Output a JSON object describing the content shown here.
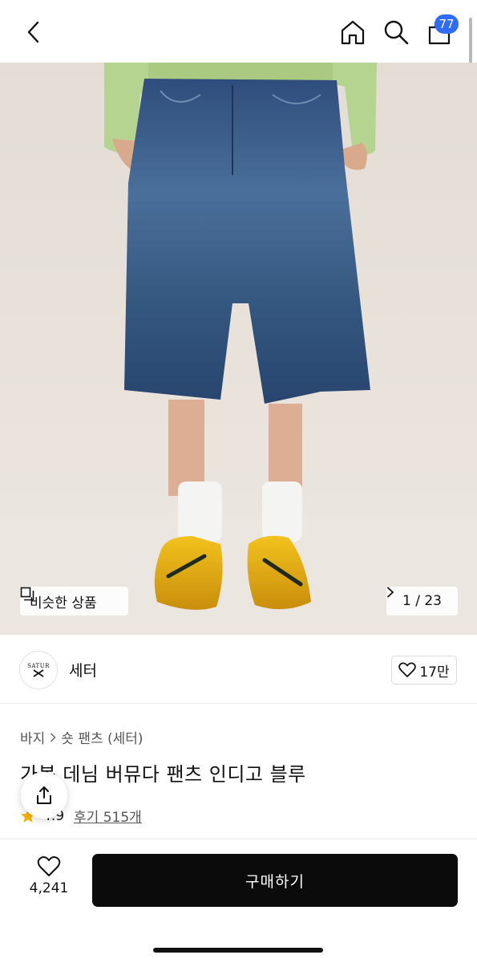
{
  "header": {
    "cart_count": "77",
    "icons": [
      "chevron-left-icon",
      "home-icon",
      "search-icon",
      "shopping-bag-icon"
    ]
  },
  "gallery": {
    "similar_label": "비슷한 상품",
    "counter": "1 / 23"
  },
  "brand": {
    "logo_text": "SATUR",
    "name": "세터",
    "like_count": "17만"
  },
  "product": {
    "breadcrumb": [
      "바지",
      "숏 팬츠 (세터)"
    ],
    "title": "가봄 데님 버뮤다 팬츠 인디고 블루",
    "rating": "4.9",
    "reviews": "후기 515개"
  },
  "bottom": {
    "wish_count": "4,241",
    "buy_label": "구매하기"
  },
  "colors": {
    "accent": "#2f6bff",
    "buy_button": "#0b0b0b",
    "star": "#f7b500"
  }
}
